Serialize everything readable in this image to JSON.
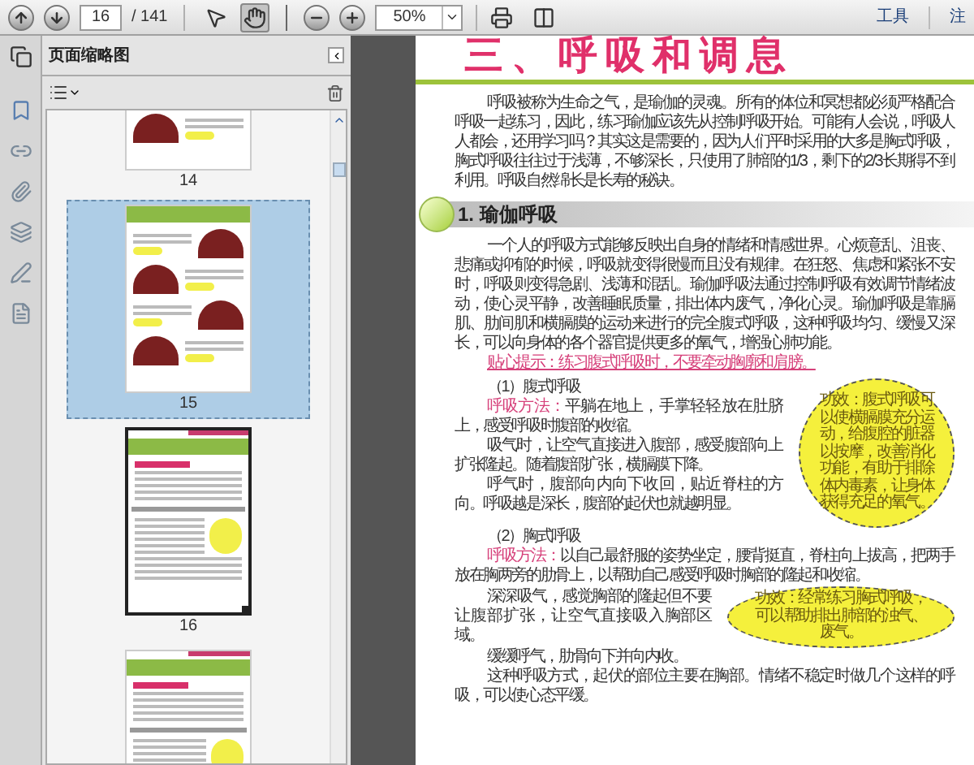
{
  "toolbar": {
    "page_number": "16",
    "page_count": "/ 141",
    "tools": [
      {
        "kind": "select",
        "selected": false
      },
      {
        "kind": "hand",
        "selected": true
      }
    ],
    "zoom": "50%",
    "menus": [
      "工具",
      "注"
    ]
  },
  "sidebar": {
    "title": "页面缩略图",
    "thumbnails": [
      {
        "label": "14",
        "kind": "poses",
        "selected": false,
        "in_view": false
      },
      {
        "label": "15",
        "kind": "poses",
        "selected": true,
        "in_view": false
      },
      {
        "label": "16",
        "kind": "text",
        "selected": false,
        "in_view": true
      },
      {
        "kind": "text",
        "selected": false,
        "in_view": false
      }
    ]
  },
  "page": {
    "title": "三、呼吸和调息",
    "intro": "呼吸被称为生命之气，是瑜伽的灵魂。所有的体位和冥想都必须严格配合呼吸一起练习，因此，练习瑜伽应该先从控制呼吸开始。可能有人会说，呼吸人人都会，还用学习吗？其实这是需要的，因为人们平时采用的大多是胸式呼吸，胸式呼吸往往过于浅薄，不够深长，只使用了肺部的1/3，剩下的2/3长期得不到利用。呼吸自然绵长是长寿的秘诀。",
    "section": {
      "heading": "1. 瑜伽呼吸",
      "paragraph": "一个人的呼吸方式能够反映出自身的情绪和情感世界。心烦意乱、沮丧、悲痛或抑郁的时候，呼吸就变得很慢而且没有规律。在狂怒、焦虑和紧张不安时，呼吸则变得急剧、浅薄和混乱。瑜伽呼吸法通过控制呼吸有效调节情绪波动，使心灵平静，改善睡眠质量，排出体内废气，净化心灵。瑜伽呼吸是靠膈肌、肋间肌和横膈膜的运动来进行的完全腹式呼吸，这种呼吸均匀、缓慢又深长，可以向身体的各个器官提供更多的氧气，增强心肺功能。",
      "tip": "贴心提示：练习腹式呼吸时，不要牵动胸廓和肩膀。",
      "parts": [
        {
          "heading": "（1）腹式呼吸",
          "method_label": "呼吸方法：",
          "method": "平躺在地上，手掌轻轻放在肚脐上，感受呼吸时腹部的收缩。",
          "paragraphs": [
            "吸气时，让空气直接进入腹部，感受腹部向上扩张隆起。随着腹部扩张，横膈膜下降。",
            "呼气时，腹部向内向下收回，贴近脊柱的方向。呼吸越是深长，腹部的起伏也就越明显。"
          ],
          "note": "功效：腹式呼吸可以使横膈膜充分运动，给腹腔的脏器以按摩，改善消化功能，有助于排除体内毒素，让身体获得充足的氧气。",
          "kind": "side"
        },
        {
          "heading": "（2）胸式呼吸",
          "method_label": "呼吸方法：",
          "method": "以自己最舒服的姿势坐定，腰背挺直，脊柱向上拔高，把两手放在胸两旁的肋骨上，以帮助自己感受呼吸时胸部的隆起和收缩。",
          "paragraphs": [
            "深深吸气，感觉胸部的隆起但不要让腹部扩张，让空气直接吸入胸部区域。",
            "缓缓呼气，肋骨向下并向内收。",
            "这种呼吸方式，起伏的部位主要在胸部。情绪不稳定时做几个这样的呼吸，可以使心态平缓。"
          ],
          "note": "功效：经常练习胸式呼吸，可以帮助排出肺部的浊气、废气。",
          "kind": "inline"
        }
      ]
    }
  }
}
